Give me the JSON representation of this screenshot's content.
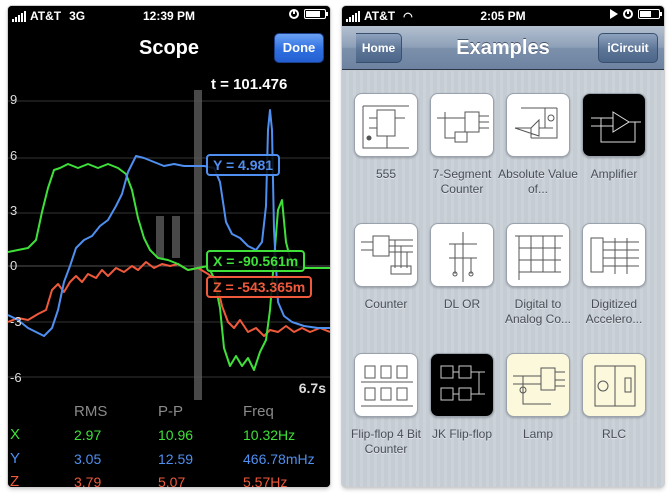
{
  "left_screen": {
    "status": {
      "carrier": "AT&T",
      "network": "3G",
      "time": "12:39 PM"
    },
    "nav": {
      "title": "Scope",
      "done_label": "Done"
    },
    "plot": {
      "y_ticks": [
        "9",
        "6",
        "3",
        "0",
        "-3",
        "-6"
      ],
      "cursor_time": "t = 101.476",
      "time_scale": "6.7s",
      "readouts": {
        "y": "Y = 4.981",
        "x": "X = -90.561m",
        "z": "Z = -543.365m"
      }
    },
    "stats": {
      "headers": [
        "RMS",
        "P-P",
        "Freq"
      ],
      "rows": [
        {
          "label": "X",
          "rms": "2.97",
          "pp": "10.96",
          "freq": "10.32Hz"
        },
        {
          "label": "Y",
          "rms": "3.05",
          "pp": "12.59",
          "freq": "466.78mHz"
        },
        {
          "label": "Z",
          "rms": "3.79",
          "pp": "5.07",
          "freq": "5.57Hz"
        }
      ]
    },
    "colors": {
      "x": "#3fe03a",
      "y": "#4f8ff0",
      "z": "#f05a3c"
    }
  },
  "right_screen": {
    "status": {
      "carrier": "AT&T",
      "time": "2:05 PM"
    },
    "nav": {
      "title": "Examples",
      "home_label": "Home",
      "icircuit_label": "iCircuit"
    },
    "examples": [
      {
        "label": "555"
      },
      {
        "label": "7-Segment Counter"
      },
      {
        "label": "Absolute Value of..."
      },
      {
        "label": "Amplifier"
      },
      {
        "label": "Counter"
      },
      {
        "label": "DL OR"
      },
      {
        "label": "Digital to Analog Co..."
      },
      {
        "label": "Digitized Accelero..."
      },
      {
        "label": "Flip-flop 4 Bit Counter"
      },
      {
        "label": "JK Flip-flop"
      },
      {
        "label": "Lamp"
      },
      {
        "label": "RLC"
      }
    ]
  }
}
